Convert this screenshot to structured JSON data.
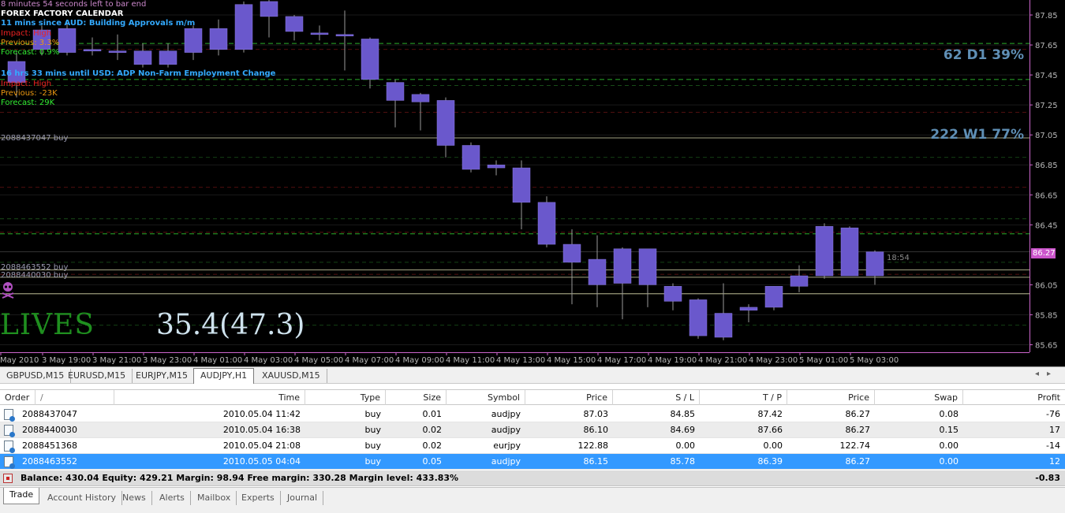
{
  "chart": {
    "timer_text": "8 minutes 54 seconds left to bar end",
    "ff_title": "FOREX FACTORY CALENDAR",
    "event1": "11 mins since AUD: Building Approvals m/m",
    "impact1": "Impact: High",
    "previous1": "Previous: 3.3%",
    "forecast1": "Forecast: 0.9%",
    "event2": "16 hrs 33 mins until USD: ADP Non-Farm Employment Change",
    "impact2": "Impact: High",
    "previous2": "Previous: -23K",
    "forecast2": "Forecast: 29K",
    "order_label1": "2088437047 buy",
    "order_label2": "2088463552 buy",
    "order_label3": "2088440030 buy",
    "stat_d1": "62  D1 39%",
    "stat_w1": "222  W1 77%",
    "lives": "LIVES",
    "big_number": "35.4(47.3)",
    "bar_timer": "18:54",
    "current_price": "86.27",
    "colors": {
      "background": "#000000",
      "candle": "#6a58cc",
      "wick": "#9a9a9a",
      "grid": "#1a1a1a",
      "axis": "#cc66cc",
      "sl_line": "#cc2222",
      "tp_line": "#33cc33",
      "order_line": "#ffffcc"
    }
  },
  "chart_data": {
    "type": "candlestick",
    "symbol": "AUDJPY,H1",
    "y_ticks": [
      "87.85",
      "87.65",
      "87.45",
      "87.25",
      "87.05",
      "86.85",
      "86.65",
      "86.45",
      "86.27",
      "86.05",
      "85.85",
      "85.65"
    ],
    "ylim": [
      85.6,
      87.95
    ],
    "x_labels": [
      "May 2010",
      "3 May 19:00",
      "3 May 21:00",
      "3 May 23:00",
      "4 May 01:00",
      "4 May 03:00",
      "4 May 05:00",
      "4 May 07:00",
      "4 May 09:00",
      "4 May 11:00",
      "4 May 13:00",
      "4 May 15:00",
      "4 May 17:00",
      "4 May 19:00",
      "4 May 21:00",
      "4 May 23:00",
      "5 May 01:00",
      "5 May 03:00"
    ],
    "candles": [
      {
        "o": 87.54,
        "h": 87.6,
        "l": 87.3,
        "c": 87.4
      },
      {
        "o": 87.62,
        "h": 87.78,
        "l": 87.58,
        "c": 87.75
      },
      {
        "o": 87.6,
        "h": 87.8,
        "l": 87.58,
        "c": 87.76
      },
      {
        "o": 87.62,
        "h": 87.7,
        "l": 87.58,
        "c": 87.62
      },
      {
        "o": 87.61,
        "h": 87.72,
        "l": 87.55,
        "c": 87.61
      },
      {
        "o": 87.52,
        "h": 87.66,
        "l": 87.5,
        "c": 87.61
      },
      {
        "o": 87.52,
        "h": 87.66,
        "l": 87.5,
        "c": 87.61
      },
      {
        "o": 87.6,
        "h": 87.78,
        "l": 87.55,
        "c": 87.76
      },
      {
        "o": 87.62,
        "h": 87.82,
        "l": 87.58,
        "c": 87.76
      },
      {
        "o": 87.62,
        "h": 87.94,
        "l": 87.6,
        "c": 87.92
      },
      {
        "o": 87.84,
        "h": 87.95,
        "l": 87.7,
        "c": 87.94
      },
      {
        "o": 87.84,
        "h": 87.85,
        "l": 87.68,
        "c": 87.74
      },
      {
        "o": 87.73,
        "h": 87.78,
        "l": 87.68,
        "c": 87.73
      },
      {
        "o": 87.72,
        "h": 87.88,
        "l": 87.48,
        "c": 87.72
      },
      {
        "o": 87.42,
        "h": 87.7,
        "l": 87.36,
        "c": 87.69
      },
      {
        "o": 87.28,
        "h": 87.42,
        "l": 87.1,
        "c": 87.4
      },
      {
        "o": 87.27,
        "h": 87.33,
        "l": 87.08,
        "c": 87.32
      },
      {
        "o": 86.98,
        "h": 87.3,
        "l": 86.9,
        "c": 87.28
      },
      {
        "o": 86.82,
        "h": 87.0,
        "l": 86.8,
        "c": 86.98
      },
      {
        "o": 86.83,
        "h": 86.88,
        "l": 86.78,
        "c": 86.85
      },
      {
        "o": 86.6,
        "h": 86.88,
        "l": 86.42,
        "c": 86.83
      },
      {
        "o": 86.32,
        "h": 86.64,
        "l": 86.3,
        "c": 86.6
      },
      {
        "o": 86.2,
        "h": 86.42,
        "l": 85.92,
        "c": 86.32
      },
      {
        "o": 86.05,
        "h": 86.38,
        "l": 85.9,
        "c": 86.22
      },
      {
        "o": 86.06,
        "h": 86.3,
        "l": 85.82,
        "c": 86.29
      },
      {
        "o": 86.05,
        "h": 86.28,
        "l": 85.9,
        "c": 86.29
      },
      {
        "o": 85.94,
        "h": 86.06,
        "l": 85.88,
        "c": 86.04
      },
      {
        "o": 85.71,
        "h": 85.96,
        "l": 85.69,
        "c": 85.95
      },
      {
        "o": 85.7,
        "h": 86.06,
        "l": 85.68,
        "c": 85.86
      },
      {
        "o": 85.88,
        "h": 85.92,
        "l": 85.8,
        "c": 85.9
      },
      {
        "o": 85.9,
        "h": 86.04,
        "l": 85.88,
        "c": 86.04
      },
      {
        "o": 86.04,
        "h": 86.18,
        "l": 86.0,
        "c": 86.11
      },
      {
        "o": 86.11,
        "h": 86.46,
        "l": 86.09,
        "c": 86.44
      },
      {
        "o": 86.43,
        "h": 86.44,
        "l": 86.11,
        "c": 86.11
      },
      {
        "o": 86.11,
        "h": 86.28,
        "l": 86.05,
        "c": 86.27
      }
    ],
    "levels": [
      {
        "price": 87.42,
        "kind": "tp"
      },
      {
        "price": 87.66,
        "kind": "tp"
      },
      {
        "price": 86.39,
        "kind": "tp"
      },
      {
        "price": 84.85,
        "kind": "sl"
      },
      {
        "price": 87.03,
        "kind": "order"
      },
      {
        "price": 86.15,
        "kind": "order"
      },
      {
        "price": 86.1,
        "kind": "order"
      },
      {
        "price": 85.99,
        "kind": "order"
      }
    ]
  },
  "symbol_tabs": [
    {
      "label": "GBPUSD,M15",
      "active": false
    },
    {
      "label": "EURUSD,M15",
      "active": false
    },
    {
      "label": "EURJPY,M15",
      "active": false
    },
    {
      "label": "AUDJPY,H1",
      "active": true
    },
    {
      "label": "XAUUSD,M15",
      "active": false
    }
  ],
  "terminal": {
    "columns": [
      "Order",
      "/",
      "Time",
      "Type",
      "Size",
      "Symbol",
      "Price",
      "S / L",
      "T / P",
      "Price",
      "Swap",
      "Profit"
    ],
    "rows": [
      {
        "order": "2088437047",
        "time": "2010.05.04 11:42",
        "type": "buy",
        "size": "0.01",
        "symbol": "audjpy",
        "price": "87.03",
        "sl": "84.85",
        "tp": "87.42",
        "cur": "86.27",
        "swap": "0.08",
        "profit": "-76"
      },
      {
        "order": "2088440030",
        "time": "2010.05.04 16:38",
        "type": "buy",
        "size": "0.02",
        "symbol": "audjpy",
        "price": "86.10",
        "sl": "84.69",
        "tp": "87.66",
        "cur": "86.27",
        "swap": "0.15",
        "profit": "17"
      },
      {
        "order": "2088451368",
        "time": "2010.05.04 21:08",
        "type": "buy",
        "size": "0.02",
        "symbol": "eurjpy",
        "price": "122.88",
        "sl": "0.00",
        "tp": "0.00",
        "cur": "122.74",
        "swap": "0.00",
        "profit": "-14"
      },
      {
        "order": "2088463552",
        "time": "2010.05.05 04:04",
        "type": "buy",
        "size": "0.05",
        "symbol": "audjpy",
        "price": "86.15",
        "sl": "85.78",
        "tp": "86.39",
        "cur": "86.27",
        "swap": "0.00",
        "profit": "12"
      }
    ],
    "balance_text": "Balance: 430.04  Equity: 429.21  Margin: 98.94  Free margin: 330.28  Margin level: 433.83%",
    "balance_profit": "-0.83",
    "tabs": [
      {
        "label": "Trade",
        "active": true
      },
      {
        "label": "Account History",
        "active": false
      },
      {
        "label": "News",
        "active": false
      },
      {
        "label": "Alerts",
        "active": false
      },
      {
        "label": "Mailbox",
        "active": false
      },
      {
        "label": "Experts",
        "active": false
      },
      {
        "label": "Journal",
        "active": false
      }
    ]
  }
}
